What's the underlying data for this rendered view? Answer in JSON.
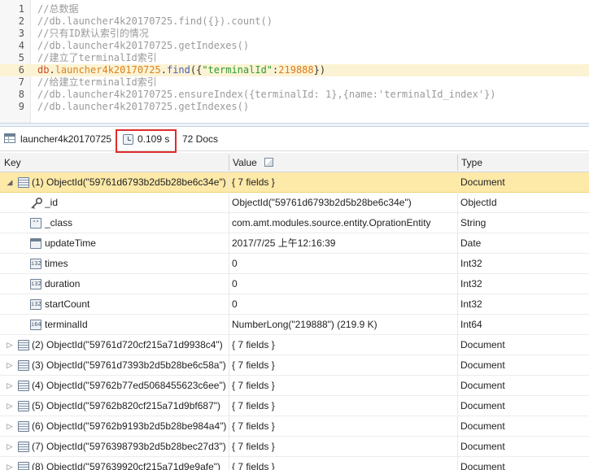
{
  "editor": {
    "lines": [
      {
        "n": "1",
        "tokens": [
          {
            "t": "//总数据",
            "c": "c-comment"
          }
        ]
      },
      {
        "n": "2",
        "tokens": [
          {
            "t": "//db.launcher4k20170725.find({}).count()",
            "c": "c-comment"
          }
        ]
      },
      {
        "n": "3",
        "tokens": [
          {
            "t": "//只有ID默认索引的情况",
            "c": "c-comment"
          }
        ]
      },
      {
        "n": "4",
        "tokens": [
          {
            "t": "//db.launcher4k20170725.getIndexes()",
            "c": "c-comment"
          }
        ]
      },
      {
        "n": "5",
        "tokens": [
          {
            "t": "//建立了terminalId索引",
            "c": "c-comment"
          }
        ]
      },
      {
        "n": "6",
        "active": true,
        "tokens": [
          {
            "t": "db",
            "c": "c-db"
          },
          {
            "t": ".",
            "c": "c-plain"
          },
          {
            "t": "launcher4k20170725",
            "c": "c-coll"
          },
          {
            "t": ".",
            "c": "c-plain"
          },
          {
            "t": "find",
            "c": "c-fn"
          },
          {
            "t": "({",
            "c": "c-plain"
          },
          {
            "t": "\"terminalId\"",
            "c": "c-str"
          },
          {
            "t": ":",
            "c": "c-plain"
          },
          {
            "t": "219888",
            "c": "c-num"
          },
          {
            "t": "})",
            "c": "c-plain"
          }
        ]
      },
      {
        "n": "7",
        "tokens": [
          {
            "t": "//给建立terminalId索引",
            "c": "c-comment"
          }
        ]
      },
      {
        "n": "8",
        "tokens": [
          {
            "t": "//db.launcher4k20170725.ensureIndex({terminalId: 1},{name:'terminalId_index'})",
            "c": "c-comment"
          }
        ]
      },
      {
        "n": "9",
        "tokens": [
          {
            "t": "//db.launcher4k20170725.getIndexes()",
            "c": "c-comment"
          }
        ]
      }
    ]
  },
  "status": {
    "collection": "launcher4k20170725",
    "time": "0.109 s",
    "docs": "72 Docs"
  },
  "grid": {
    "headers": {
      "key": "Key",
      "value": "Value",
      "type": "Type"
    },
    "expanded": {
      "key": "(1) ObjectId(\"59761d6793b2d5b28be6c34e\")",
      "value": "{ 7 fields }",
      "type": "Document",
      "fields": [
        {
          "key": "_id",
          "value": "ObjectId(\"59761d6793b2d5b28be6c34e\")",
          "type": "ObjectId",
          "icon": "key-icon",
          "glyph": ""
        },
        {
          "key": "_class",
          "value": "com.amt.modules.source.entity.OprationEntity",
          "type": "String",
          "icon": "string-type-icon",
          "glyph": "\"\""
        },
        {
          "key": "updateTime",
          "value": "2017/7/25 上午12:16:39",
          "type": "Date",
          "icon": "date-type-icon",
          "glyph": ""
        },
        {
          "key": "times",
          "value": "0",
          "type": "Int32",
          "icon": "int32-type-icon",
          "glyph": "i32"
        },
        {
          "key": "duration",
          "value": "0",
          "type": "Int32",
          "icon": "int32-type-icon",
          "glyph": "i32"
        },
        {
          "key": "startCount",
          "value": "0",
          "type": "Int32",
          "icon": "int32-type-icon",
          "glyph": "i32"
        },
        {
          "key": "terminalId",
          "value": "NumberLong(\"219888\") (219.9 K)",
          "type": "Int64",
          "icon": "int64-type-icon",
          "glyph": "i64"
        }
      ]
    },
    "documents": [
      {
        "key": "(2) ObjectId(\"59761d720cf215a71d9938c4\")",
        "value": "{ 7 fields }",
        "type": "Document"
      },
      {
        "key": "(3) ObjectId(\"59761d7393b2d5b28be6c58a\")",
        "value": "{ 7 fields }",
        "type": "Document"
      },
      {
        "key": "(4) ObjectId(\"59762b77ed5068455623c6ee\")",
        "value": "{ 7 fields }",
        "type": "Document"
      },
      {
        "key": "(5) ObjectId(\"59762b820cf215a71d9bf687\")",
        "value": "{ 7 fields }",
        "type": "Document"
      },
      {
        "key": "(6) ObjectId(\"59762b9193b2d5b28be984a4\")",
        "value": "{ 7 fields }",
        "type": "Document"
      },
      {
        "key": "(7) ObjectId(\"5976398793b2d5b28bec27d3\")",
        "value": "{ 7 fields }",
        "type": "Document"
      },
      {
        "key": "(8) ObjectId(\"597639920cf215a71d9e9afe\")",
        "value": "{ 7 fields }",
        "type": "Document"
      }
    ]
  }
}
